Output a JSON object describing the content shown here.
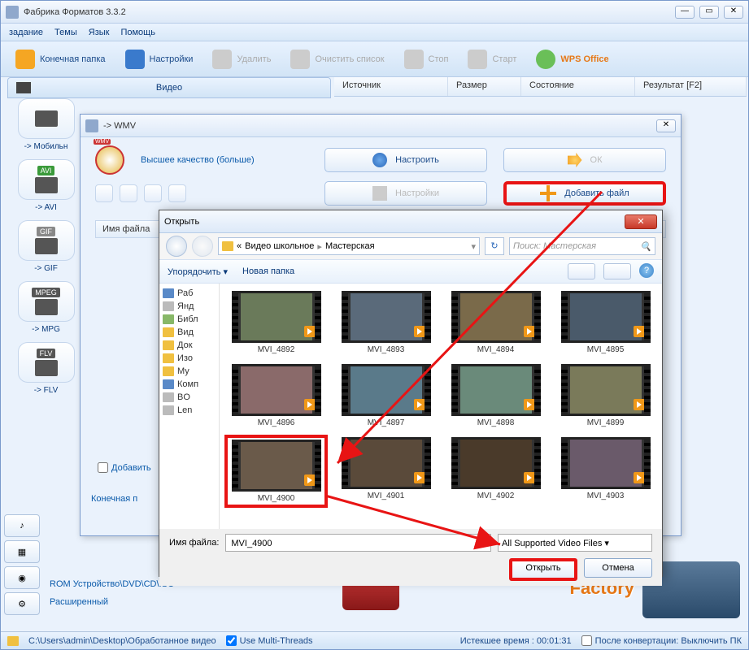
{
  "app": {
    "title": "Фабрика Форматов 3.3.2"
  },
  "menu": {
    "task": "задание",
    "themes": "Темы",
    "lang": "Язык",
    "help": "Помощь"
  },
  "toolbar": {
    "dest": "Конечная папка",
    "settings": "Настройки",
    "delete": "Удалить",
    "clear": "Очистить список",
    "stop": "Стоп",
    "start": "Старт",
    "wps": "WPS Office"
  },
  "columns": {
    "source": "Источник",
    "size": "Размер",
    "state": "Состояние",
    "result": "Результат [F2]"
  },
  "tab_video": "Видео",
  "formats": [
    {
      "label": "-> Мобильн",
      "chip": "",
      "chipColor": "#555"
    },
    {
      "label": "-> AVI",
      "chip": "AVI",
      "chipColor": "#3a9a3a"
    },
    {
      "label": "-> GIF",
      "chip": "GIF",
      "chipColor": "#888"
    },
    {
      "label": "-> MPG",
      "chip": "MPEG",
      "chipColor": "#555"
    },
    {
      "label": "-> FLV",
      "chip": "FLV",
      "chipColor": "#555"
    }
  ],
  "wmv": {
    "title": "-> WMV",
    "quality": "Высшее качество (больше)",
    "configure": "Настроить",
    "ok": "ОК",
    "settings": "Настройки",
    "add_file": "Добавить файл",
    "list_col": "Имя файла",
    "add_item": "Добавить",
    "dest_folder": "Конечная п"
  },
  "open": {
    "title": "Открыть",
    "bc_prefix": "«",
    "bc1": "Видео школьное",
    "bc2": "Мастерская",
    "search_placeholder": "Поиск: Мастерская",
    "organize": "Упорядочить",
    "new_folder": "Новая папка",
    "tree": [
      "Раб",
      "Янд",
      "Библ",
      "Вид",
      "Док",
      "Изо",
      "Му",
      "Комп",
      "BО",
      "Len"
    ],
    "files": [
      "MVI_4892",
      "MVI_4893",
      "MVI_4894",
      "MVI_4895",
      "MVI_4896",
      "MVI_4897",
      "MVI_4898",
      "MVI_4899",
      "MVI_4900",
      "MVI_4901",
      "MVI_4902",
      "MVI_4903"
    ],
    "selected_index": 8,
    "filename_label": "Имя файла:",
    "filename_value": "MVI_4900",
    "filter": "All Supported Video Files",
    "open_btn": "Открыть",
    "cancel_btn": "Отмена"
  },
  "bottom": {
    "rom": "ROM Устройство\\DVD\\CD\\ISO",
    "advanced": "Расширенный"
  },
  "status": {
    "path": "C:\\Users\\admin\\Desktop\\Обработанное видео",
    "multithread": "Use Multi-Threads",
    "elapsed": "Истекшее время : 00:01:31",
    "after": "После конвертации: Выключить ПК"
  },
  "logo": "Factory",
  "thumb_colors": [
    "#6a7a5a",
    "#5a6a7a",
    "#7a6a4a",
    "#4a5a6a",
    "#8a6a6a",
    "#5a7a8a",
    "#6a8a7a",
    "#7a7a5a",
    "#6a5a4a",
    "#5a4a3a",
    "#4a3a2a",
    "#6a5a6a"
  ]
}
